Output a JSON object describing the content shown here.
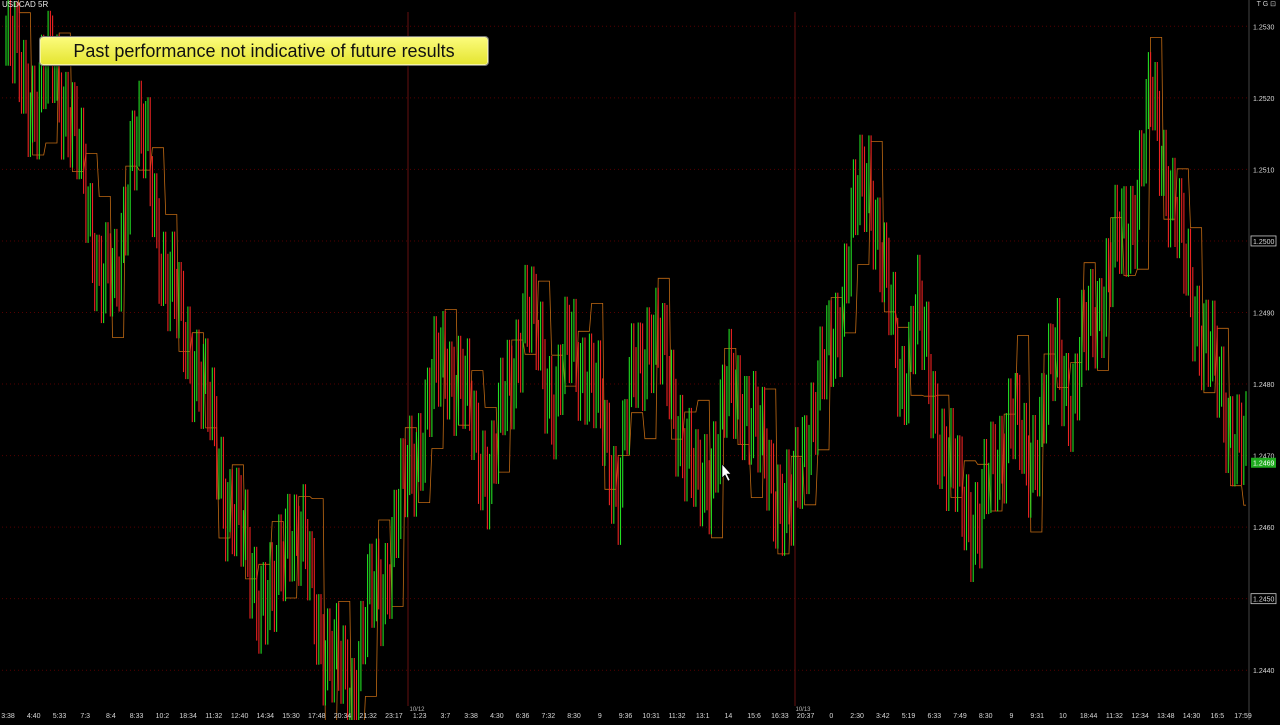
{
  "header": {
    "symbol": "USDCAD 5R",
    "corner": "T G ⊡"
  },
  "disclaimer": "Past performance not indicative of future results",
  "colors": {
    "background": "#000000",
    "up": "#22dd22",
    "down": "#ee2222",
    "stop_line": "#ff8c1a",
    "grid": "#550000",
    "axis_text": "#d8d8d8",
    "disclaimer_bg": "#f0f050"
  },
  "chart_data": {
    "type": "renko-range-bars",
    "y_ticks": [
      "1.2530",
      "1.2520",
      "1.2510",
      "1.2500",
      "1.2490",
      "1.2480",
      "1.2470",
      "1.2460",
      "1.2450",
      "1.2440"
    ],
    "y_values": [
      1.253,
      1.252,
      1.251,
      1.25,
      1.249,
      1.248,
      1.247,
      1.246,
      1.245,
      1.244
    ],
    "ylim": [
      1.2435,
      1.2532
    ],
    "boxed_levels": [
      "1.2500",
      "1.2450"
    ],
    "current_price": "1.2469",
    "current_price_value": 1.2469,
    "x_labels": [
      "3:38",
      "4:40",
      "5:33",
      "7:3",
      "8:4",
      "8:33",
      "10:2",
      "18:34",
      "11:32",
      "12:40",
      "14:34",
      "15:30",
      "17:48",
      "20:34",
      "21:32",
      "23:17",
      "1:23",
      "3:7",
      "3:38",
      "4:30",
      "6:36",
      "7:32",
      "8:30",
      "9",
      "9:36",
      "10:31",
      "11:32",
      "13:1",
      "14",
      "15:6",
      "16:33",
      "20:37",
      "0",
      "2:30",
      "3:42",
      "5:19",
      "6:33",
      "7:49",
      "8:30",
      "9",
      "9:31",
      "10",
      "18:44",
      "11:32",
      "12:34",
      "13:48",
      "14:30",
      "16:5",
      "17:59"
    ],
    "date_labels": [
      "10/12",
      "10/13"
    ],
    "price_path": [
      1.2528,
      1.2523,
      1.2519,
      1.2525,
      1.2518,
      1.2507,
      1.2496,
      1.2492,
      1.2515,
      1.2512,
      1.2497,
      1.2489,
      1.2484,
      1.2475,
      1.2465,
      1.2458,
      1.2452,
      1.2448,
      1.2462,
      1.2456,
      1.2446,
      1.244,
      1.2437,
      1.2448,
      1.2452,
      1.2462,
      1.247,
      1.2478,
      1.2484,
      1.248,
      1.2471,
      1.2468,
      1.248,
      1.249,
      1.2485,
      1.2477,
      1.2486,
      1.2482,
      1.2474,
      1.2466,
      1.2481,
      1.2488,
      1.2482,
      1.2474,
      1.2464,
      1.247,
      1.2478,
      1.2479,
      1.2471,
      1.2466,
      1.2461,
      1.2474,
      1.248,
      1.2489,
      1.2503,
      1.251,
      1.2494,
      1.248,
      1.249,
      1.2479,
      1.2468,
      1.2464,
      1.246,
      1.2469,
      1.2476,
      1.2468,
      1.2476,
      1.2484,
      1.2478,
      1.2488,
      1.2494,
      1.25,
      1.2506,
      1.252,
      1.2509,
      1.2497,
      1.2489,
      1.2481,
      1.2475,
      1.2469
    ]
  }
}
